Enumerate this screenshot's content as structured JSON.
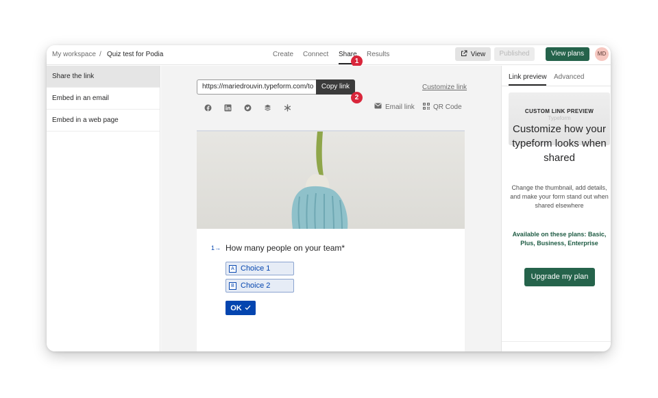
{
  "breadcrumb": {
    "workspace": "My workspace",
    "separator": "/",
    "title": "Quiz test for Podia"
  },
  "nav": {
    "create": "Create",
    "connect": "Connect",
    "share": "Share",
    "results": "Results",
    "active": "share"
  },
  "steps": {
    "first": "1",
    "second": "2"
  },
  "toolbar": {
    "view_label": "View",
    "published_label": "Published",
    "view_plans_label": "View plans",
    "avatar_initials": "MD"
  },
  "sidebar": {
    "items": [
      {
        "label": "Share the link",
        "active": true
      },
      {
        "label": "Embed in an email",
        "active": false
      },
      {
        "label": "Embed in a web page",
        "active": false
      }
    ]
  },
  "share": {
    "url_value": "https://mariedrouvin.typeform.com/to",
    "copy_label": "Copy link",
    "customize_label": "Customize link",
    "social_icons": [
      "facebook-icon",
      "linkedin-icon",
      "twitter-icon",
      "buffer-icon",
      "asterisk-icon"
    ],
    "email_label": "Email link",
    "qr_label": "QR Code"
  },
  "preview": {
    "question_number": "1",
    "question": "How many people on your team*",
    "choices": [
      {
        "key": "A",
        "label": "Choice 1"
      },
      {
        "key": "B",
        "label": "Choice 2"
      }
    ],
    "ok_label": "OK"
  },
  "right_panel": {
    "tab_link_preview": "Link preview",
    "tab_advanced": "Advanced",
    "card_title": "CUSTOM LINK PREVIEW",
    "card_ghost": "Typeform",
    "heading": "Customize how your typeform looks when shared",
    "description": "Change the thumbnail, add details, and make your form stand out when shared elsewhere",
    "plans_text": "Available on these plans: Basic, Plus, Business, Enterprise",
    "upgrade_label": "Upgrade my plan"
  },
  "colors": {
    "brand_green": "#25634b",
    "accent_blue": "#0445af",
    "step_badge_red": "#d9263b"
  }
}
